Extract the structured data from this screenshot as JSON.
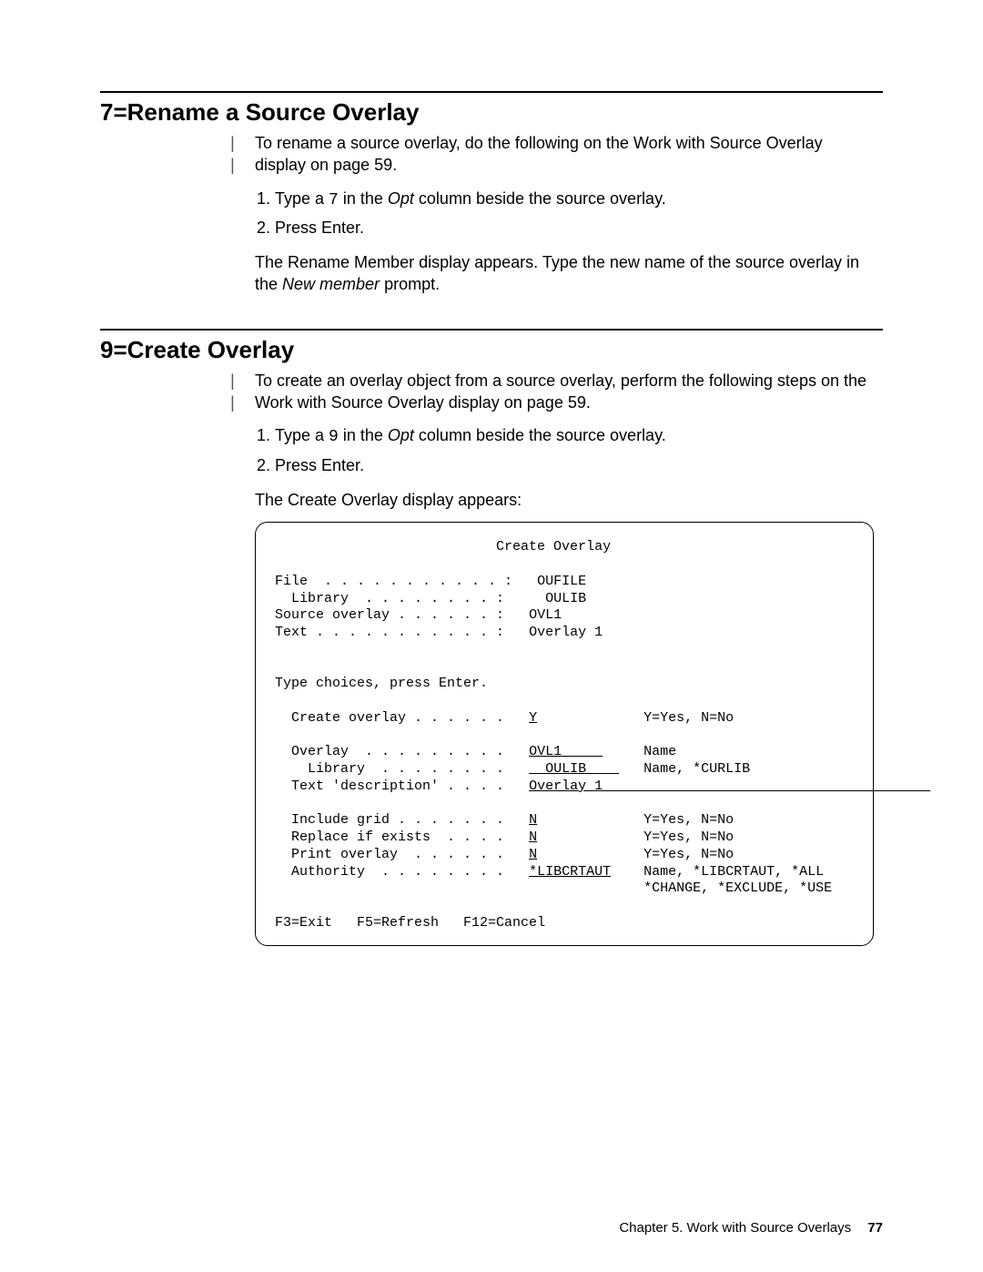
{
  "section1": {
    "heading": "7=Rename a Source Overlay",
    "intro": "To rename a source overlay, do the following on the Work with Source Overlay display on page 59.",
    "step1_pre": "Type a ",
    "step1_code": "7",
    "step1_mid": " in the ",
    "step1_ital": "Opt",
    "step1_post": " column beside the source overlay.",
    "step2": "Press Enter.",
    "after_pre": "The Rename Member display appears.  Type the new name of the source overlay in the ",
    "after_ital": "New member",
    "after_post": " prompt."
  },
  "section2": {
    "heading": "9=Create Overlay",
    "intro": "To create an overlay object from a source overlay, perform the following steps on the Work with Source Overlay display on page 59.",
    "step1_pre": "Type a ",
    "step1_code": "9",
    "step1_mid": " in the ",
    "step1_ital": "Opt",
    "step1_post": " column beside the source overlay.",
    "step2": "Press Enter.",
    "after": "The Create Overlay display appears:"
  },
  "screen": {
    "title": "Create Overlay",
    "file_label": "File  . . . . . . . . . . . :",
    "file_val": "OUFILE",
    "lib1_label": "  Library  . . . . . . . . :",
    "lib1_val": "  OULIB",
    "src_label": "Source overlay . . . . . . :",
    "src_val": "OVL1",
    "text_label": "Text . . . . . . . . . . . :",
    "text_val": "Overlay 1",
    "type_choices": "Type choices, press Enter.",
    "create_label": "  Create overlay . . . . . .",
    "create_val": "Y",
    "create_help": "Y=Yes, N=No",
    "ovl_label": "  Overlay  . . . . . . . . .",
    "ovl_val": "OVL1     ",
    "ovl_help": "Name",
    "lib2_label": "    Library  . . . . . . . .",
    "lib2_val": "  OULIB    ",
    "lib2_help": "Name, *CURLIB",
    "desc_label": "  Text 'description' . . . .",
    "desc_val": "Overlay 1                                        ",
    "grid_label": "  Include grid . . . . . . .",
    "grid_val": "N",
    "grid_help": "Y=Yes, N=No",
    "replace_label": "  Replace if exists  . . . .",
    "replace_val": "N",
    "replace_help": "Y=Yes, N=No",
    "print_label": "  Print overlay  . . . . . .",
    "print_val": "N",
    "print_help": "Y=Yes, N=No",
    "auth_label": "  Authority  . . . . . . . .",
    "auth_val": "*LIBCRTAUT",
    "auth_help1": "Name, *LIBCRTAUT, *ALL",
    "auth_help2": "*CHANGE, *EXCLUDE, *USE",
    "fkeys": "F3=Exit   F5=Refresh   F12=Cancel"
  },
  "footer": {
    "chapter": "Chapter 5.  Work with Source Overlays",
    "page": "77"
  }
}
